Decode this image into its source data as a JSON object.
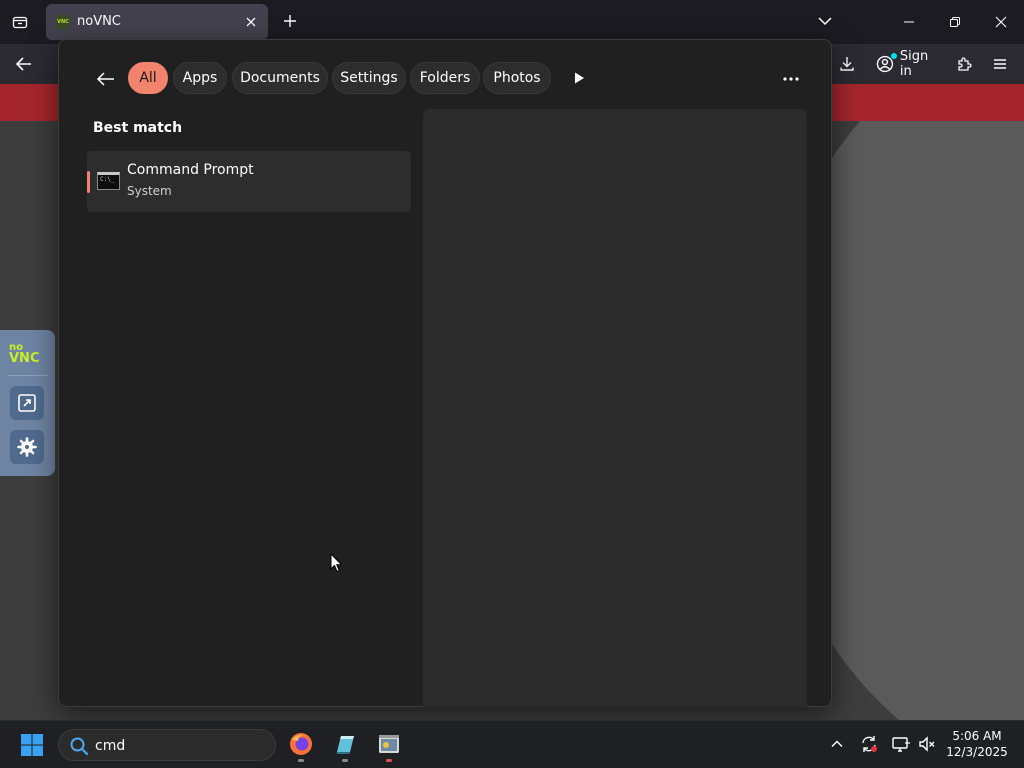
{
  "browser": {
    "tab": {
      "title": "noVNC",
      "favicon_text": "VNC"
    },
    "signin_label": "Sign in"
  },
  "novnc": {
    "logo_line1": "no",
    "logo_line2": "VNC"
  },
  "search_panel": {
    "filters": [
      {
        "label": "All",
        "active": true
      },
      {
        "label": "Apps"
      },
      {
        "label": "Documents"
      },
      {
        "label": "Settings"
      },
      {
        "label": "Folders"
      },
      {
        "label": "Photos"
      }
    ],
    "best_match_label": "Best match",
    "best_match": {
      "title": "Command Prompt",
      "subtitle": "System",
      "icon_text": "C:\\_"
    }
  },
  "taskbar": {
    "search": {
      "value": "cmd"
    },
    "clock": {
      "time": "5:06 AM",
      "date": "12/3/2025"
    }
  },
  "colors": {
    "accent": "#f2846d",
    "banner": "#a4262c",
    "novnc_bar": "#6e84a3"
  }
}
